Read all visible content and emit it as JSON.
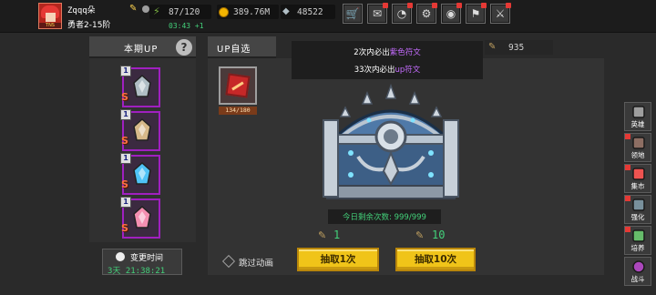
{
  "player": {
    "name": "Zqqq朵",
    "rank": "勇者2-15阶",
    "avatar_badge": "TNS"
  },
  "resources": {
    "energy": "87/120",
    "energy_timer": "03:43 +1",
    "gold": "389.76M",
    "gems": "48522",
    "tickets": "935"
  },
  "topbar_buttons": [
    {
      "name": "shop-button",
      "icon": "cart-icon",
      "glyph": "🛒"
    },
    {
      "name": "mail-button",
      "icon": "mail-icon",
      "glyph": "✉"
    },
    {
      "name": "rank-button",
      "icon": "chart-icon",
      "glyph": "◔"
    },
    {
      "name": "settings-button",
      "icon": "gear-icon",
      "glyph": "⚙"
    },
    {
      "name": "wheel-button",
      "icon": "color-wheel-icon",
      "glyph": "◉"
    },
    {
      "name": "quest-button",
      "icon": "quest-icon",
      "glyph": "⚑"
    },
    {
      "name": "battle-button",
      "icon": "swords-icon",
      "glyph": "⚔"
    }
  ],
  "left_panel": {
    "title": "本期UP",
    "items": [
      {
        "level": "1",
        "grade": "S",
        "kind": "spiked-helm",
        "color": "#b0bec5"
      },
      {
        "level": "1",
        "grade": "S",
        "kind": "crossed-axes",
        "color": "#d7b98a"
      },
      {
        "level": "1",
        "grade": "S",
        "kind": "ice-crystal",
        "color": "#4fc3f7"
      },
      {
        "level": "1",
        "grade": "S",
        "kind": "star-shard",
        "color": "#f48fb1"
      }
    ],
    "timer_label": "变更时间",
    "timer_value": "3天 21:38:21"
  },
  "mid_panel": {
    "title": "UP自选",
    "pick_count": "134/180",
    "info_line1_prefix": "2次内必出",
    "info_line1_highlight": "紫色符文",
    "info_line2_prefix": "33次内必出",
    "info_line2_highlight": "up符文",
    "remaining": "今日剩余次数: 999/999",
    "cost1": "1",
    "cost10": "10",
    "skip_label": "跳过动画",
    "draw1_label": "抽取1次",
    "draw10_label": "抽取10次"
  },
  "side_nav": [
    {
      "label": "英雄",
      "icon": "helmet-icon",
      "alert": false
    },
    {
      "label": "领地",
      "icon": "castle-icon",
      "alert": true
    },
    {
      "label": "集市",
      "icon": "market-icon",
      "alert": true
    },
    {
      "label": "强化",
      "icon": "anvil-icon",
      "alert": true
    },
    {
      "label": "培养",
      "icon": "potion-icon",
      "alert": true
    },
    {
      "label": "战斗",
      "icon": "portal-icon",
      "alert": false
    }
  ],
  "colors": {
    "accent_green": "#43d17a",
    "purple": "#c56cff",
    "gold_button": "#f0c419"
  }
}
